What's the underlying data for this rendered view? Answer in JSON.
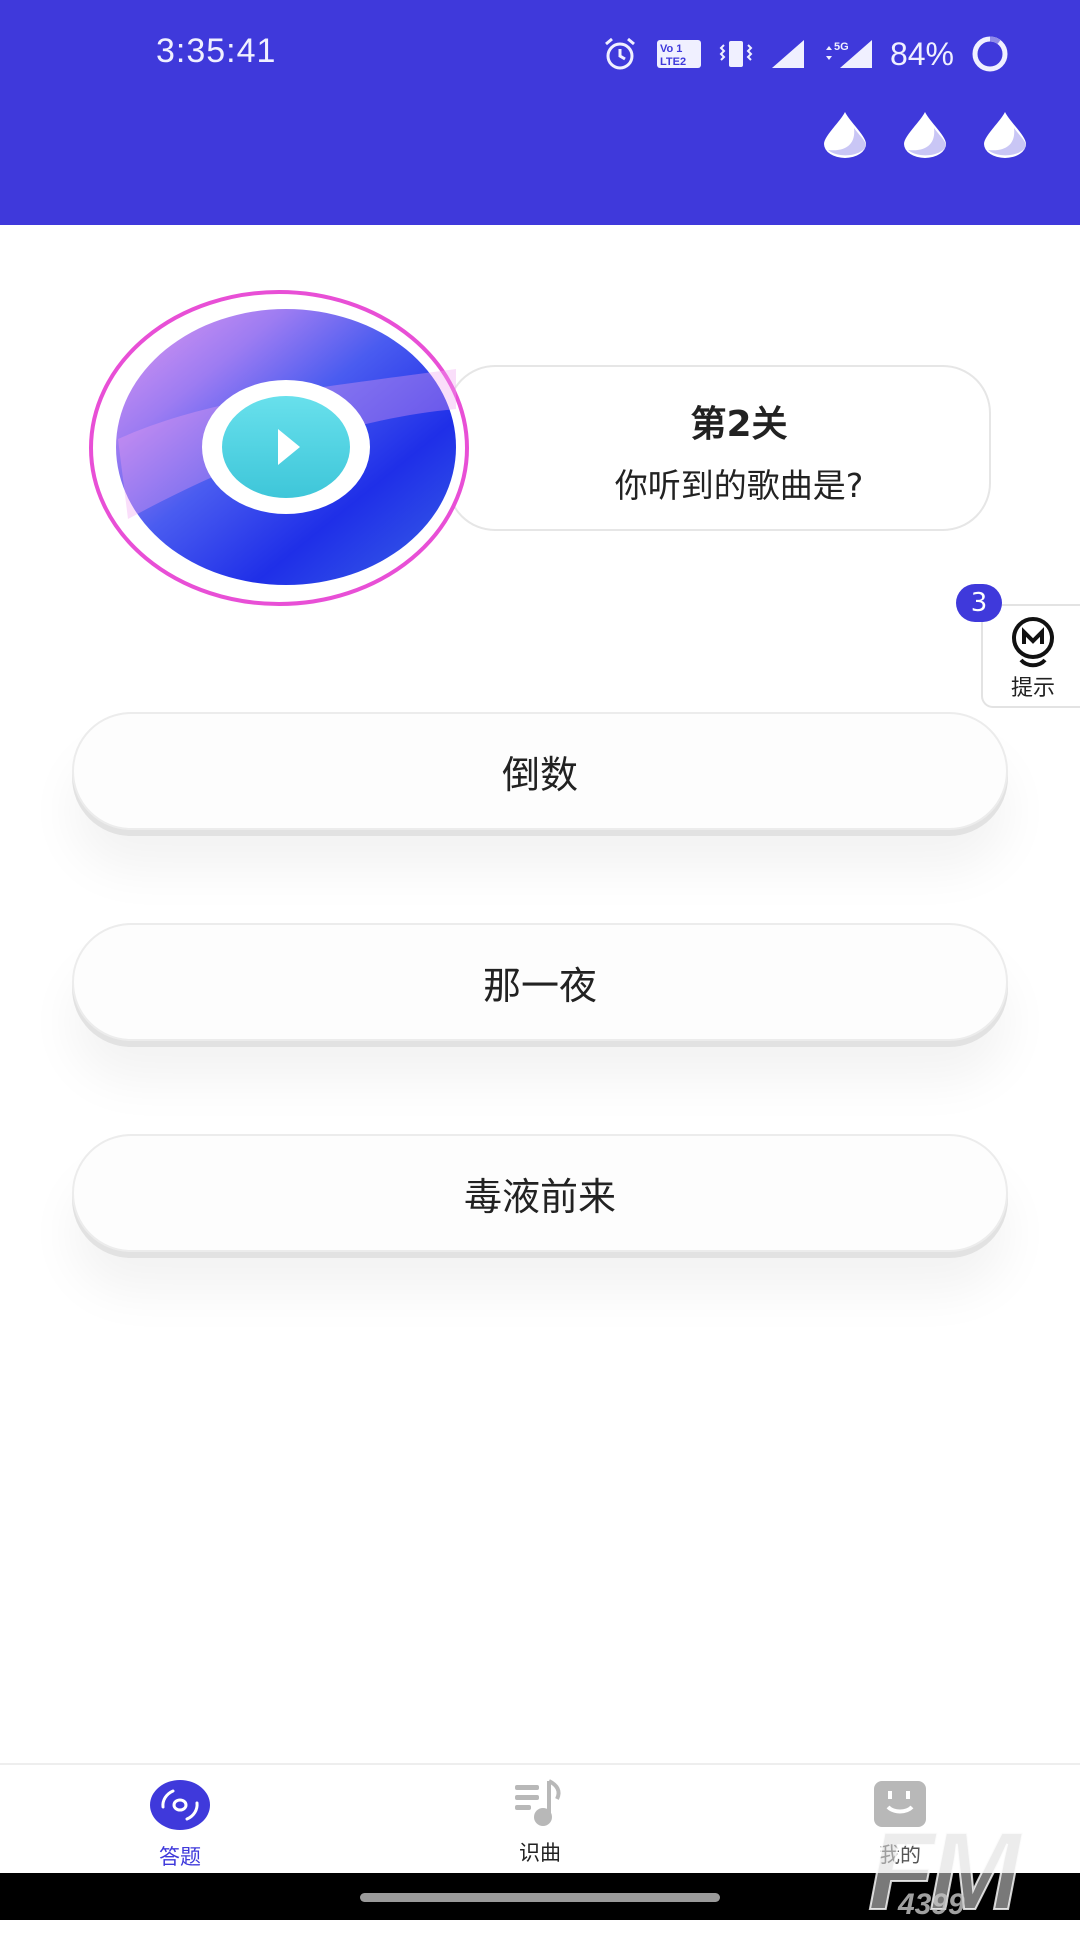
{
  "status_bar": {
    "time": "3:35:41",
    "battery": "84%",
    "icons": [
      "alarm-icon",
      "volte-icon",
      "vibrate-icon",
      "signal-icon",
      "5g-signal-icon",
      "battery-ring-icon"
    ]
  },
  "header": {
    "lives": [
      "drop-icon",
      "drop-icon",
      "drop-icon"
    ]
  },
  "level": {
    "title": "第2关",
    "question": "你听到的歌曲是?"
  },
  "hint": {
    "count": "3",
    "label": "提示"
  },
  "options": [
    {
      "label": "倒数"
    },
    {
      "label": "那一夜"
    },
    {
      "label": "毒液前来"
    }
  ],
  "bottom_nav": {
    "items": [
      {
        "label": "答题",
        "icon": "disc-icon",
        "active": true
      },
      {
        "label": "识曲",
        "icon": "music-note-icon",
        "active": false
      },
      {
        "label": "我的",
        "icon": "face-icon",
        "active": false
      }
    ]
  },
  "watermark": {
    "main": "FM",
    "sub": "4399"
  },
  "colors": {
    "brand": "#3f39db",
    "ring": "#e84fd6",
    "play": "#4fd3e0",
    "inactive": "#b8b8b8"
  }
}
